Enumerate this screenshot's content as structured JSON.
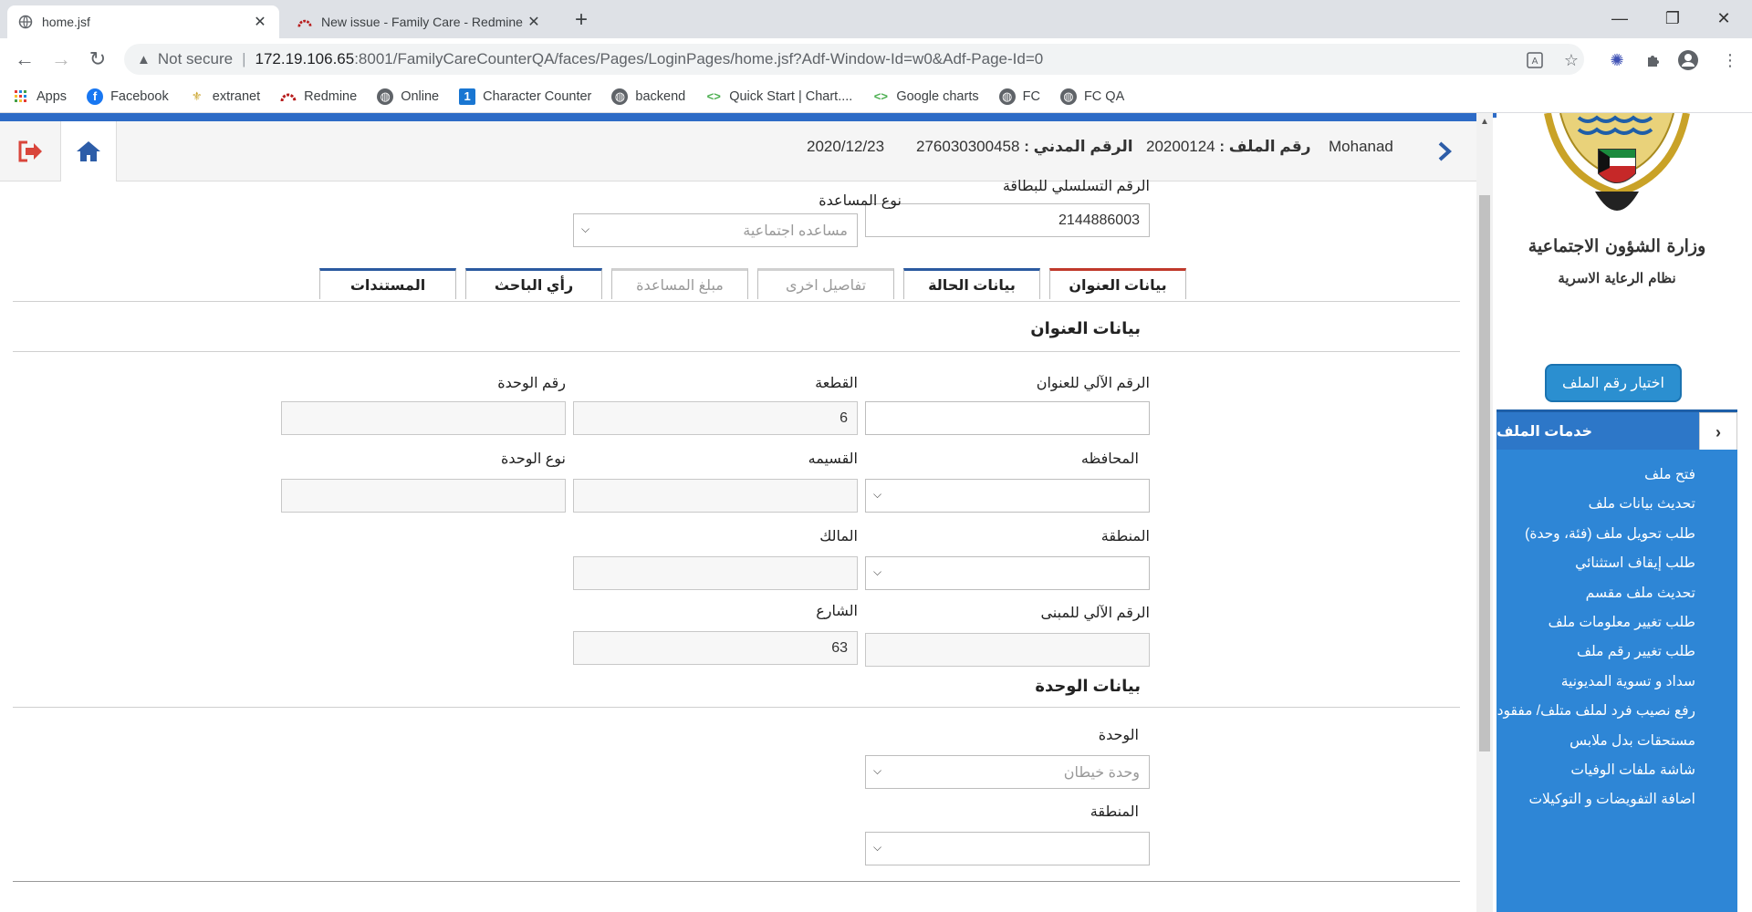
{
  "browser": {
    "tabs": [
      {
        "title": "home.jsf",
        "active": true,
        "favicon": "globe-icon"
      },
      {
        "title": "New issue - Family Care - Redmine",
        "active": false,
        "favicon": "redmine-icon"
      }
    ],
    "new_tab_label": "+",
    "address": {
      "security_label": "Not secure",
      "host": "172.19.106.65",
      "path": ":8001/FamilyCareCounterQA/faces/Pages/LoginPages/home.jsf?Adf-Window-Id=w0&Adf-Page-Id=0"
    },
    "bookmarks": [
      {
        "label": "Apps",
        "icon": "apps-grid-icon",
        "color": "#e53935"
      },
      {
        "label": "Facebook",
        "icon": "facebook-icon",
        "color": "#1877f2"
      },
      {
        "label": "extranet",
        "icon": "emblem-icon",
        "color": "#c8a023"
      },
      {
        "label": "Redmine",
        "icon": "redmine-icon",
        "color": "#b71c1c"
      },
      {
        "label": "Online",
        "icon": "globe-icon",
        "color": "#5f6368"
      },
      {
        "label": "Character Counter",
        "icon": "counter-icon",
        "color": "#1976d2"
      },
      {
        "label": "backend",
        "icon": "globe-icon",
        "color": "#5f6368"
      },
      {
        "label": "Quick Start | Chart....",
        "icon": "charts-icon",
        "color": "#4caf50"
      },
      {
        "label": "Google charts",
        "icon": "charts-icon",
        "color": "#4caf50"
      },
      {
        "label": "FC",
        "icon": "globe-icon",
        "color": "#5f6368"
      },
      {
        "label": "FC QA",
        "icon": "globe-icon",
        "color": "#5f6368"
      }
    ]
  },
  "header": {
    "user_name": "Mohanad",
    "file_no_label": "رقم الملف :",
    "file_no_value": "20200124",
    "civil_id_label": "الرقم المدني :",
    "civil_id_value": "276030300458",
    "date": "2020/12/23"
  },
  "sidebar": {
    "ministry_name": "وزارة الشؤون الاجتماعية",
    "system_name": "نظام الرعاية الاسرية",
    "select_file_button": "اختيار رقم الملف",
    "services_title": "خدمات الملف",
    "services": [
      "فتح ملف",
      "تحديث بيانات ملف",
      "طلب تحويل ملف (فئة، وحدة)",
      "طلب إيقاف استثنائي",
      "تحديث ملف مقسم",
      "طلب تغيير معلومات ملف",
      "طلب تغيير رقم ملف",
      "سداد و تسوية المديونية",
      "رفع نصيب فرد لملف متلف/ مفقود",
      "مستحقات بدل ملابس",
      "شاشة ملفات الوفيات",
      "اضافة التفويضات و التوكيلات"
    ]
  },
  "form": {
    "card_serial_label": "الرقم التسلسلي للبطاقة",
    "card_serial_value": "2144886003",
    "assistance_type_label": "نوع المساعدة",
    "assistance_type_value": "مساعده اجتماعية",
    "tabs": [
      {
        "label": "بيانات العنوان",
        "state": "active"
      },
      {
        "label": "بيانات الحالة",
        "state": "nav"
      },
      {
        "label": "تفاصيل اخرى",
        "state": "disabled"
      },
      {
        "label": "مبلغ المساعدة",
        "state": "disabled"
      },
      {
        "label": "رأي الباحث",
        "state": "nav"
      },
      {
        "label": "المستندات",
        "state": "nav"
      }
    ],
    "address_section_title": "بيانات العنوان",
    "address_auto_no_label": "الرقم الآلي للعنوان",
    "address_auto_no_value": "",
    "block_label": "القطعة",
    "block_value": "6",
    "unit_no_label": "رقم الوحدة",
    "unit_no_value": "",
    "governorate_label": "المحافظه",
    "governorate_value": "",
    "plot_label": "القسيمه",
    "plot_value": "",
    "unit_type_label": "نوع الوحدة",
    "unit_type_value": "",
    "area_label": "المنطقة",
    "area_value": "",
    "owner_label": "المالك",
    "owner_value": "",
    "building_auto_no_label": "الرقم الآلي للمبنى",
    "building_auto_no_value": "",
    "street_label": "الشارع",
    "street_value": "63",
    "unit_section_title": "بيانات الوحدة",
    "unit_label": "الوحدة",
    "unit_value": "وحدة خيطان",
    "unit_area_label": "المنطقة",
    "unit_area_value": ""
  },
  "colors": {
    "accent_blue": "#2d6bc6",
    "sidebar_blue": "#2e86d6",
    "active_tab_red": "#c0392b",
    "logout_red": "#d9453b"
  }
}
